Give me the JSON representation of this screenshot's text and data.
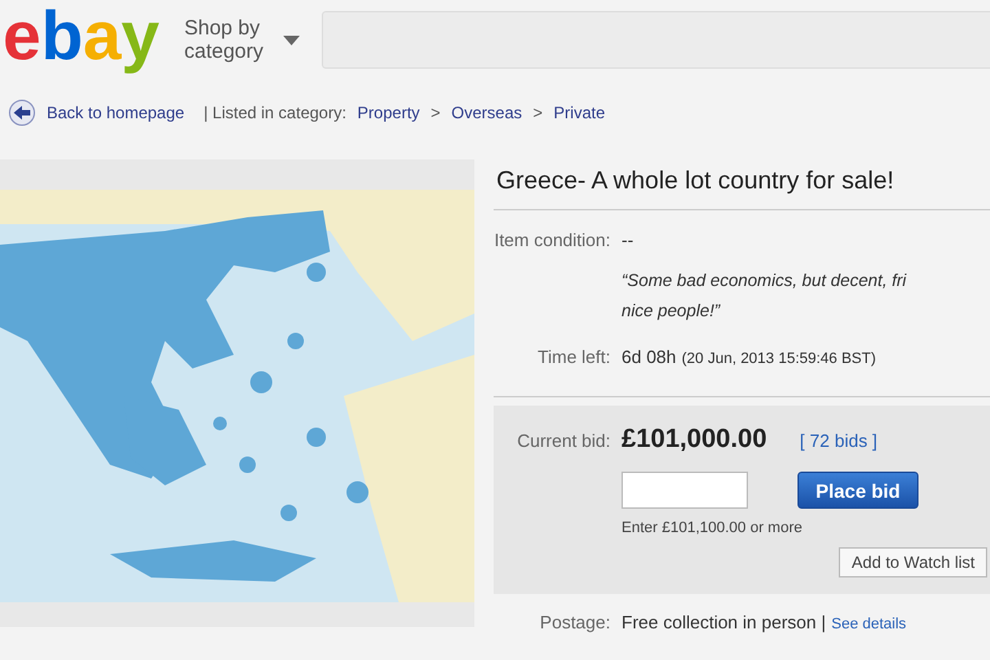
{
  "header": {
    "logo": [
      {
        "text": "e",
        "color": "#e53238"
      },
      {
        "text": "b",
        "color": "#0064d2"
      },
      {
        "text": "a",
        "color": "#f5af02"
      },
      {
        "text": "y",
        "color": "#86b817"
      }
    ],
    "shop_by_category": "Shop by category"
  },
  "breadcrumb": {
    "back": "Back to homepage",
    "listed_in": "| Listed in category:",
    "links": [
      "Property",
      "Overseas",
      "Private"
    ],
    "separator": ">"
  },
  "item": {
    "title": "Greece- A whole lot country for sale!",
    "condition_label": "Item condition:",
    "condition_value": "--",
    "quote_lines": [
      "“Some bad economics, but decent, fri",
      "nice people!”"
    ],
    "time_label": "Time left:",
    "time_value": "6d 08h",
    "time_detail": "(20 Jun, 2013  15:59:46 BST)"
  },
  "bid": {
    "label": "Current bid:",
    "price": "£101,000.00",
    "bids": "[ 72 bids ]",
    "button": "Place bid",
    "hint": "Enter £101,100.00 or more",
    "watch": "Add to Watch list"
  },
  "postage": {
    "label": "Postage:",
    "value": "Free collection in person |",
    "link": "See details"
  }
}
